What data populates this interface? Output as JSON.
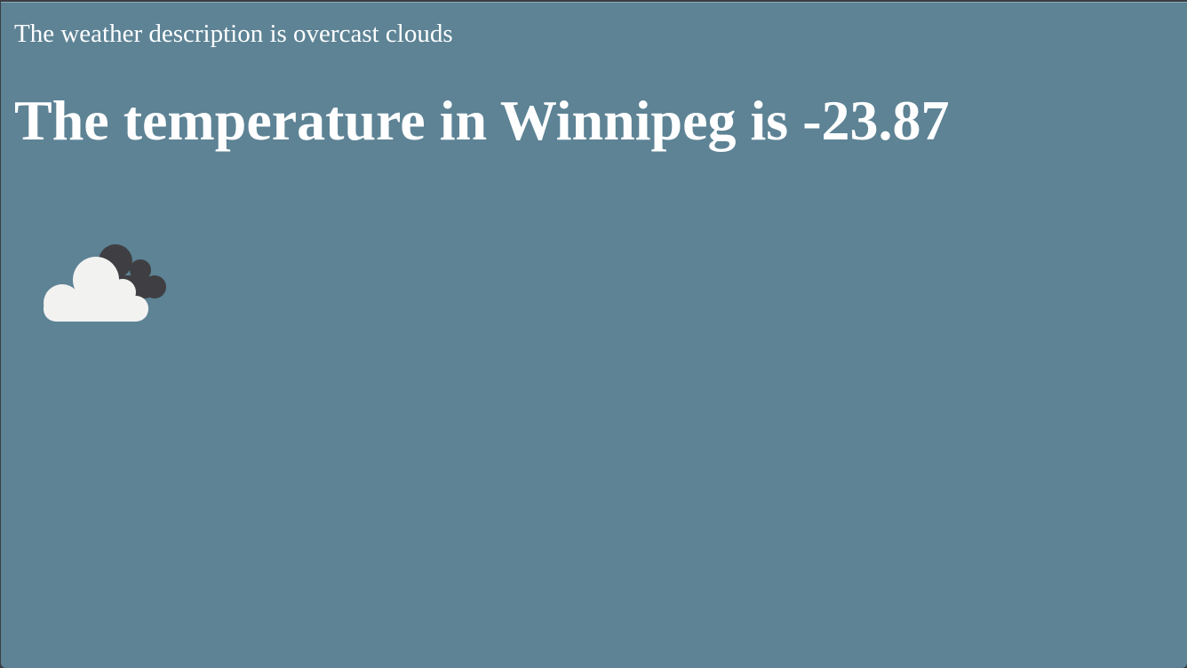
{
  "weather": {
    "description": "The weather description is overcast clouds",
    "temperature_text": "The temperature in Winnipeg is -23.87",
    "icon": "overcast-clouds-icon"
  },
  "colors": {
    "background": "#5d8395",
    "text": "#ffffff",
    "cloud_front": "#f2f2f1",
    "cloud_back": "#3f3f43"
  }
}
